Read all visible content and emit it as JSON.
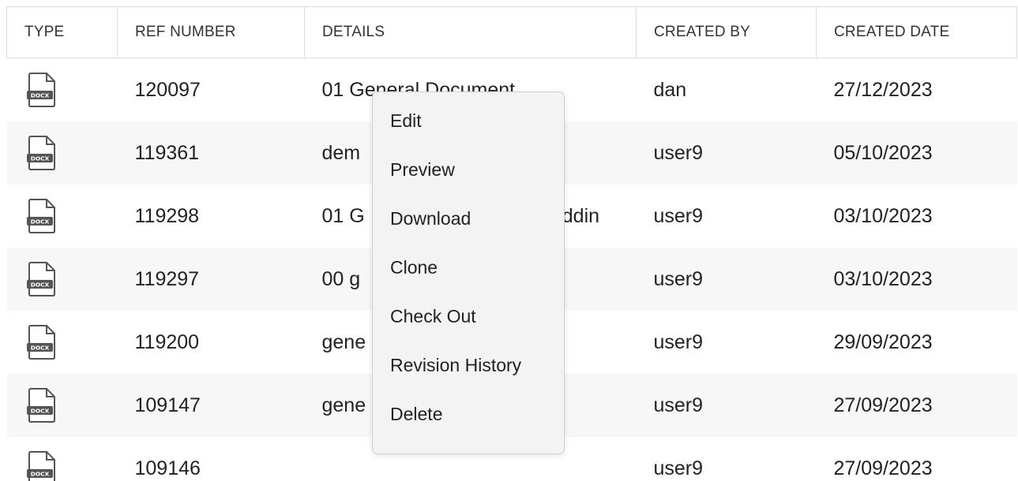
{
  "table": {
    "columns": [
      "TYPE",
      "REF NUMBER",
      "DETAILS",
      "CREATED BY",
      "CREATED DATE"
    ],
    "rows": [
      {
        "type_icon": "docx-file-icon",
        "type_label": "DOCX",
        "ref": "120097",
        "details": "01 General Document",
        "created_by": "dan",
        "created_date": "27/12/2023"
      },
      {
        "type_icon": "docx-file-icon",
        "type_label": "DOCX",
        "ref": "119361",
        "details": "dem",
        "created_by": "user9",
        "created_date": "05/10/2023"
      },
      {
        "type_icon": "docx-file-icon",
        "type_label": "DOCX",
        "ref": "119298",
        "details": "01 G                                  addin",
        "created_by": "user9",
        "created_date": "03/10/2023"
      },
      {
        "type_icon": "docx-file-icon",
        "type_label": "DOCX",
        "ref": "119297",
        "details": "00 g",
        "created_by": "user9",
        "created_date": "03/10/2023"
      },
      {
        "type_icon": "docx-file-icon",
        "type_label": "DOCX",
        "ref": "119200",
        "details": "gene",
        "created_by": "user9",
        "created_date": "29/09/2023"
      },
      {
        "type_icon": "docx-file-icon",
        "type_label": "DOCX",
        "ref": "109147",
        "details": "gene",
        "created_by": "user9",
        "created_date": "27/09/2023"
      },
      {
        "type_icon": "docx-file-icon",
        "type_label": "DOCX",
        "ref": "109146",
        "details": "",
        "created_by": "user9",
        "created_date": "27/09/2023"
      }
    ]
  },
  "context_menu": {
    "items": [
      "Edit",
      "Preview",
      "Download",
      "Clone",
      "Check Out",
      "Revision History",
      "Delete"
    ]
  }
}
